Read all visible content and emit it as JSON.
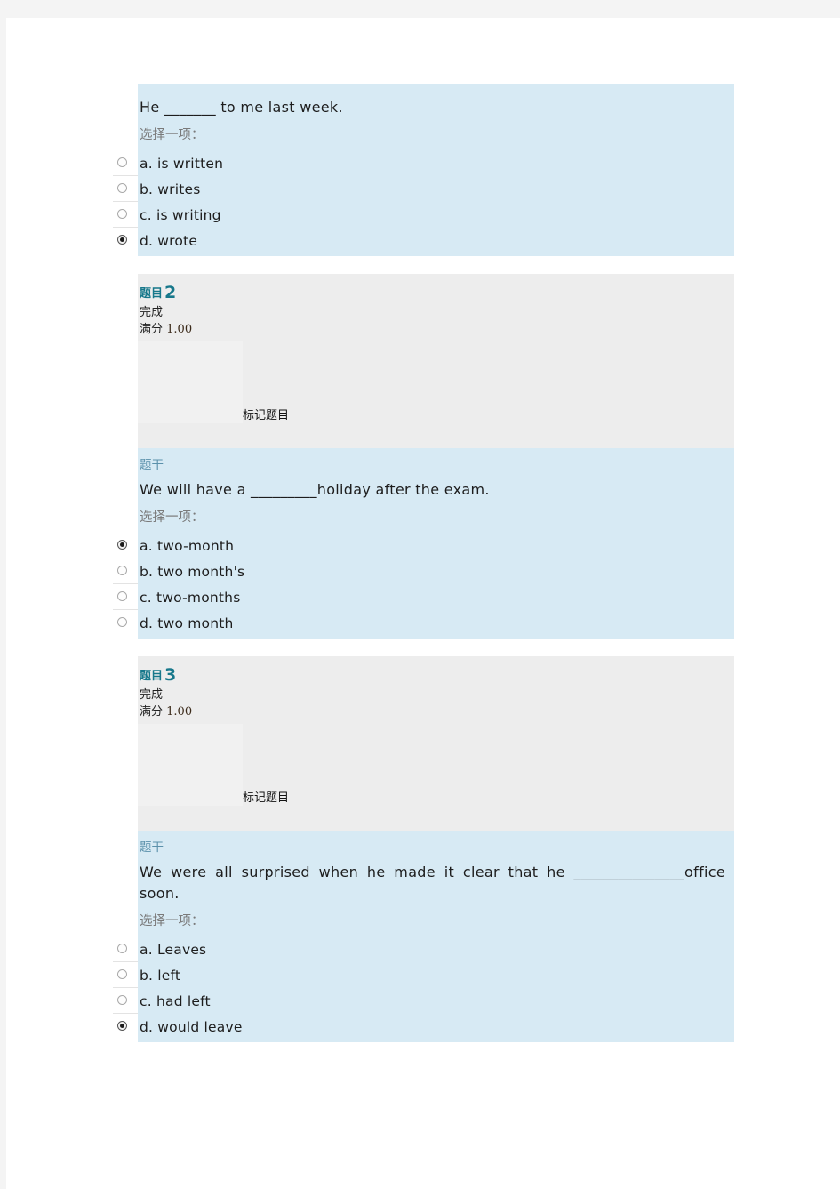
{
  "page": {
    "labels": {
      "question_prefix": "题目",
      "state_finished": "完成",
      "max_grade_prefix": "满分",
      "flag_question": "标记题目",
      "question_text_label": "题干",
      "choose_one": "选择一项："
    }
  },
  "questions": [
    {
      "number": "",
      "state": "",
      "grade_prefix": "",
      "grade_value": "",
      "flag_label": "",
      "qtext_label": "",
      "text": "He _______ to me last week.",
      "prompt": "选择一项：",
      "options": [
        {
          "label": "a. is written",
          "checked": false
        },
        {
          "label": "b. writes",
          "checked": false
        },
        {
          "label": "c. is writing",
          "checked": false
        },
        {
          "label": "d. wrote",
          "checked": true
        }
      ]
    },
    {
      "number": "2",
      "state": "完成",
      "grade_prefix": "满分",
      "grade_value": "1.00",
      "flag_label": "标记题目",
      "qtext_label": "题干",
      "text": "We will have a _________holiday after the exam.",
      "prompt": "选择一项：",
      "options": [
        {
          "label": "a. two-month",
          "checked": true
        },
        {
          "label": "b. two month's",
          "checked": false
        },
        {
          "label": "c. two-months",
          "checked": false
        },
        {
          "label": "d. two month",
          "checked": false
        }
      ]
    },
    {
      "number": "3",
      "state": "完成",
      "grade_prefix": "满分",
      "grade_value": "1.00",
      "flag_label": "标记题目",
      "qtext_label": "题干",
      "text": "We were all surprised when he made it clear that he _______________office soon.",
      "prompt": "选择一项：",
      "options": [
        {
          "label": "a. Leaves",
          "checked": false
        },
        {
          "label": "b. left",
          "checked": false
        },
        {
          "label": "c. had left",
          "checked": false
        },
        {
          "label": "d. would leave",
          "checked": true
        }
      ]
    }
  ],
  "colors": {
    "question_heading": "#17788b",
    "content_bg": "#d7eaf4",
    "info_bg": "#ededed",
    "page_bg": "#ffffff",
    "outer_bg": "#f4f4f4"
  }
}
